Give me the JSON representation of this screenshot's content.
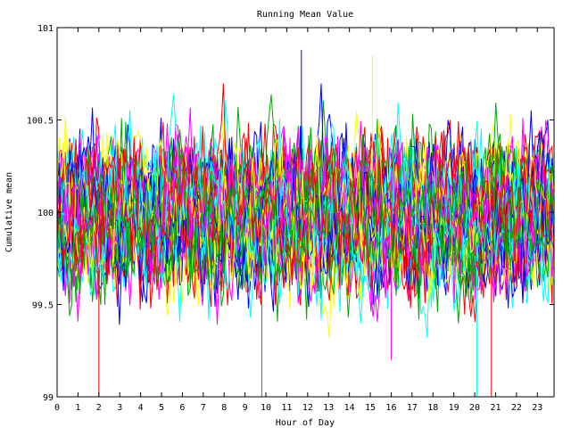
{
  "chart_data": {
    "type": "line",
    "title": "Running Mean Value",
    "xlabel": "Hour of Day",
    "ylabel": "Cumulative mean",
    "xlim": [
      0,
      23.8
    ],
    "ylim": [
      99,
      101
    ],
    "x_ticks": [
      0,
      1,
      2,
      3,
      4,
      5,
      6,
      7,
      8,
      9,
      10,
      11,
      12,
      13,
      14,
      15,
      16,
      17,
      18,
      19,
      20,
      21,
      22,
      23
    ],
    "x_tick_labels": [
      "0",
      "1",
      "2",
      "3",
      "4",
      "5",
      "6",
      "7",
      "8",
      "9",
      "10",
      "11",
      "12",
      "13",
      "14",
      "15",
      "16",
      "17",
      "18",
      "19",
      "20",
      "21",
      "22",
      "23"
    ],
    "y_ticks": [
      99,
      99.5,
      100,
      100.5,
      101
    ],
    "y_tick_labels": [
      "99",
      "99.5",
      "100",
      "100.5",
      "101"
    ],
    "grid": false,
    "series_count": 50,
    "points_per_series": 240,
    "series_colors": [
      "#ff0000",
      "#00aa00",
      "#0000ff",
      "#ffff00",
      "#ff00ff",
      "#00ffff"
    ],
    "mean_center": 100,
    "typical_band": [
      99.6,
      100.4
    ],
    "notable_values": [
      {
        "x": 2.0,
        "y": 99.0
      },
      {
        "x": 9.8,
        "y": 99.0
      },
      {
        "x": 11.7,
        "y": 100.88
      },
      {
        "x": 15.1,
        "y": 100.85
      },
      {
        "x": 16.0,
        "y": 99.2
      },
      {
        "x": 20.1,
        "y": 99.0
      },
      {
        "x": 20.8,
        "y": 99.0
      }
    ]
  }
}
